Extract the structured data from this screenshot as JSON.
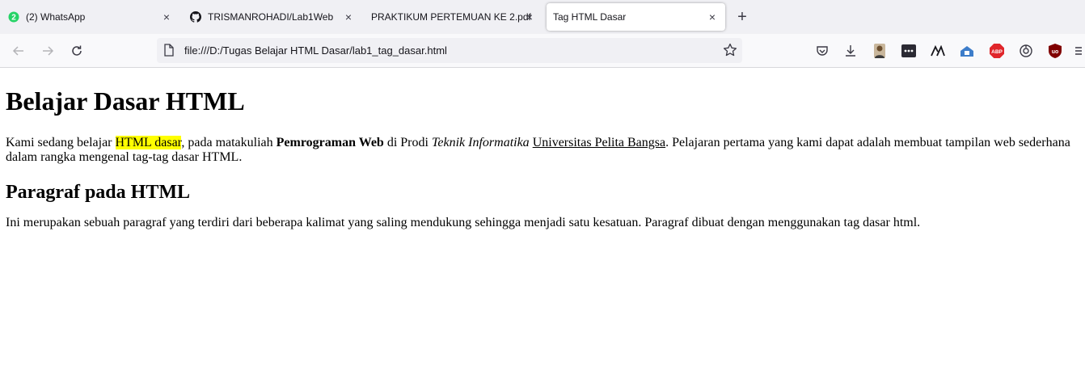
{
  "tabs": [
    {
      "title": "(2) WhatsApp",
      "favicon": "whatsapp-icon",
      "badge": "2",
      "close": "×",
      "active": false
    },
    {
      "title": "TRISMANROHADI/Lab1Web",
      "favicon": "github-icon",
      "close": "×",
      "active": false
    },
    {
      "title": "PRAKTIKUM PERTEMUAN KE 2.pdf",
      "close": "×",
      "active": false
    },
    {
      "title": "Tag HTML Dasar",
      "close": "×",
      "active": true
    }
  ],
  "new_tab_symbol": "+",
  "address_bar": {
    "url": "file:///D:/Tugas Belajar HTML Dasar/lab1_tag_dasar.html"
  },
  "toolbar_icons": [
    "back-icon",
    "forward-icon",
    "reload-icon",
    "document-icon",
    "bookmark-star-icon",
    "pocket-icon",
    "downloads-icon",
    "profile-avatar-icon",
    "extension-dots-icon",
    "extension-a-icon",
    "extension-cloud-icon",
    "adblock-plus-icon",
    "settings-dial-icon",
    "ublock-origin-icon",
    "menu-icon"
  ],
  "content": {
    "heading1": "Belajar Dasar HTML",
    "p1": {
      "t1": "Kami sedang belajar ",
      "highlight": "HTML dasar",
      "t2": ", pada matakuliah ",
      "bold": "Pemrograman Web",
      "t3": " di Prodi ",
      "italic": "Teknik Informatika",
      "t4": " ",
      "underline": "Universitas Pelita Bangsa",
      "t5": ". Pelajaran pertama yang kami dapat adalah membuat tampilan web sederhana dalam rangka mengenal tag-tag dasar HTML."
    },
    "heading2": "Paragraf pada HTML",
    "p2": "Ini merupakan sebuah paragraf yang terdiri dari beberapa kalimat yang saling mendukung sehingga menjadi satu kesatuan. Paragraf dibuat dengan menggunakan tag dasar html."
  },
  "colors": {
    "highlight": "#ffff00",
    "tabstrip": "#f0f0f4",
    "whatsapp": "#25d366",
    "abp": "#e0262b",
    "ublock": "#800000"
  }
}
